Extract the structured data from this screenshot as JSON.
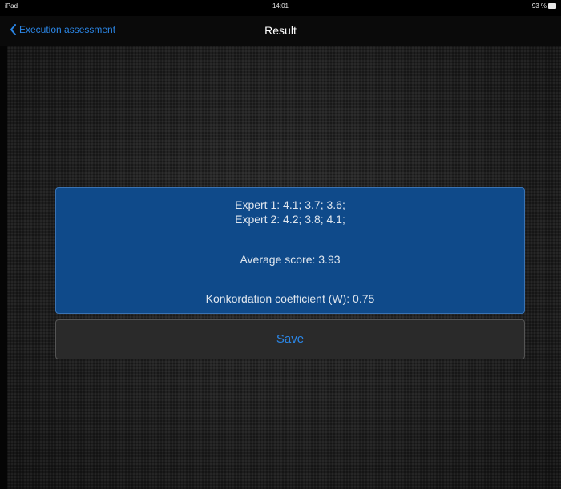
{
  "status_bar": {
    "device": "iPad",
    "time": "14:01",
    "battery": "93 %"
  },
  "nav": {
    "back_label": "Execution assessment",
    "title": "Result"
  },
  "result": {
    "expert_1": "Expert 1:  4.1;  3.7;  3.6;",
    "expert_2": "Expert 2:  4.2;  3.8;  4.1;",
    "average": "Average score: 3.93",
    "concordance": "Konkordation coefficient (W): 0.75"
  },
  "actions": {
    "save_label": "Save"
  },
  "colors": {
    "accent": "#2b86e6",
    "panel": "#0f4a8a"
  }
}
